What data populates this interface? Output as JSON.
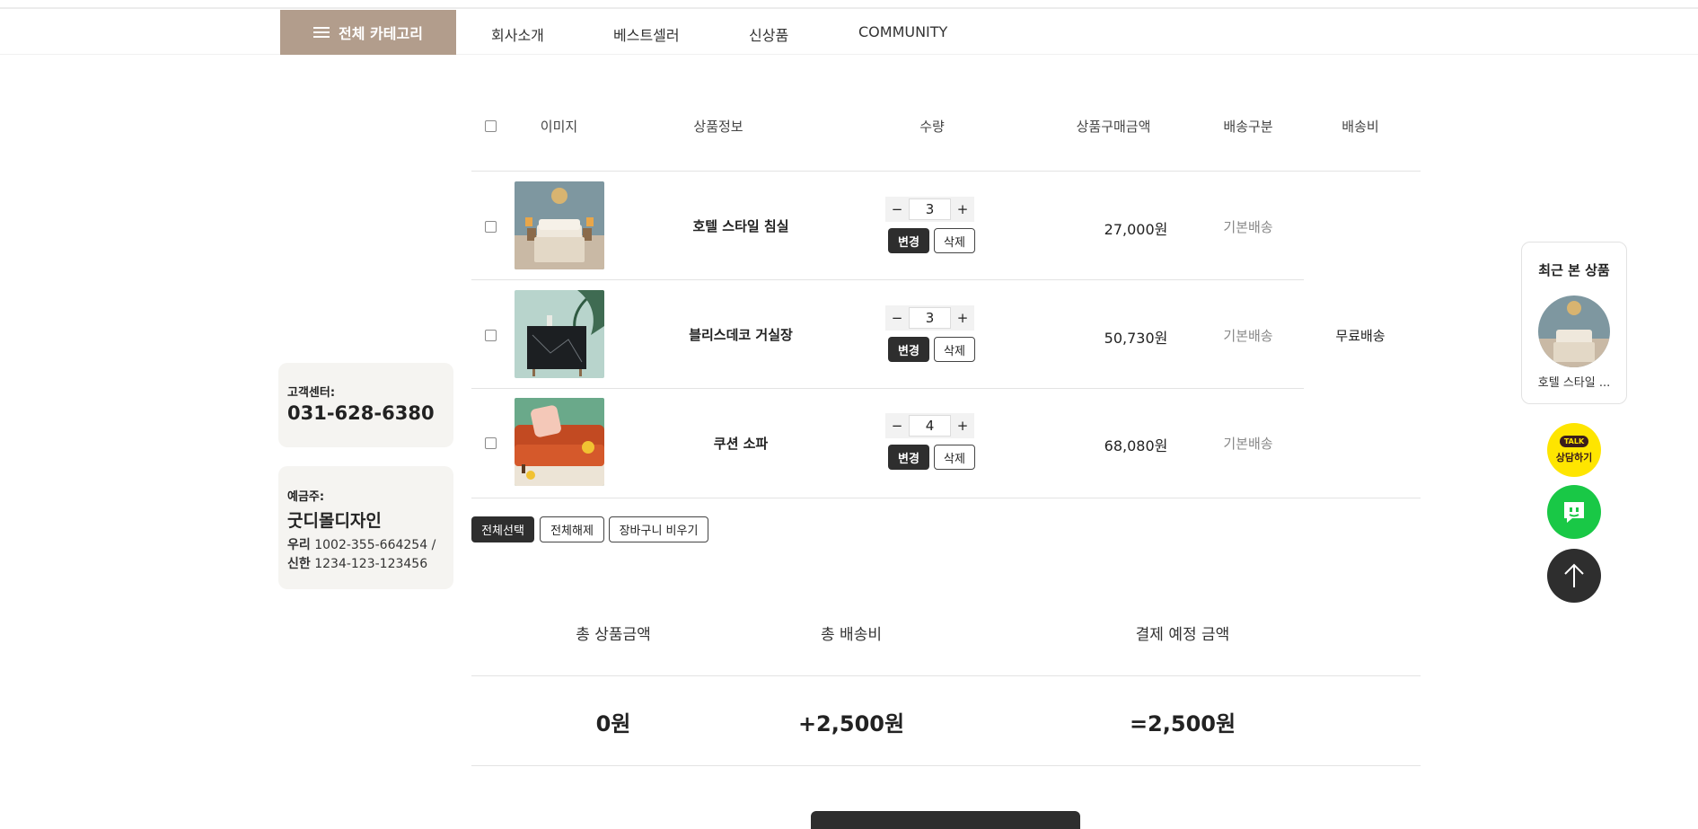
{
  "nav": {
    "category_label": "전체 카테고리",
    "items": [
      "회사소개",
      "베스트셀러",
      "신상품",
      "COMMUNITY"
    ]
  },
  "sidebar": {
    "cs_label": "고객센터:",
    "cs_phone": "031-628-6380",
    "account_label": "예금주:",
    "account_name": "굿디몰디자인",
    "banks": [
      {
        "bank": "우리",
        "number": "1002-355-664254 /"
      },
      {
        "bank": "신한",
        "number": "1234-123-123456"
      }
    ]
  },
  "table": {
    "headers": [
      "이미지",
      "상품정보",
      "수량",
      "상품구매금액",
      "배송구분",
      "배송비"
    ],
    "rows": [
      {
        "name": "호텔 스타일 침실",
        "qty": "3",
        "price": "27,000원",
        "ship_type": "기본배송",
        "image": "bedroom-image"
      },
      {
        "name": "블리스데코 거실장",
        "qty": "3",
        "price": "50,730원",
        "ship_type": "기본배송",
        "image": "cabinet-image"
      },
      {
        "name": "쿠션 소파",
        "qty": "4",
        "price": "68,080원",
        "ship_type": "기본배송",
        "image": "sofa-image"
      }
    ],
    "shipping_fee": "무료배송",
    "qty_minus": "−",
    "qty_plus": "+",
    "change_label": "변경",
    "delete_label": "삭제"
  },
  "actions": {
    "select_all": "전체선택",
    "deselect_all": "전체해제",
    "empty_cart": "장바구니 비우기"
  },
  "summary": {
    "labels": [
      "총 상품금액",
      "총 배송비",
      "결제 예정 금액"
    ],
    "values": [
      "0원",
      "+2,500원",
      "=2,500원"
    ]
  },
  "recent": {
    "title": "최근 본 상품",
    "item_label": "호텔 스타일 ..."
  },
  "floating": {
    "kakao_top": "TALK",
    "kakao_label": "상담하기"
  },
  "colors": {
    "accent": "#b29d8c",
    "dark": "#2e2e2e",
    "kakao": "#fee500",
    "naver": "#19c846"
  }
}
